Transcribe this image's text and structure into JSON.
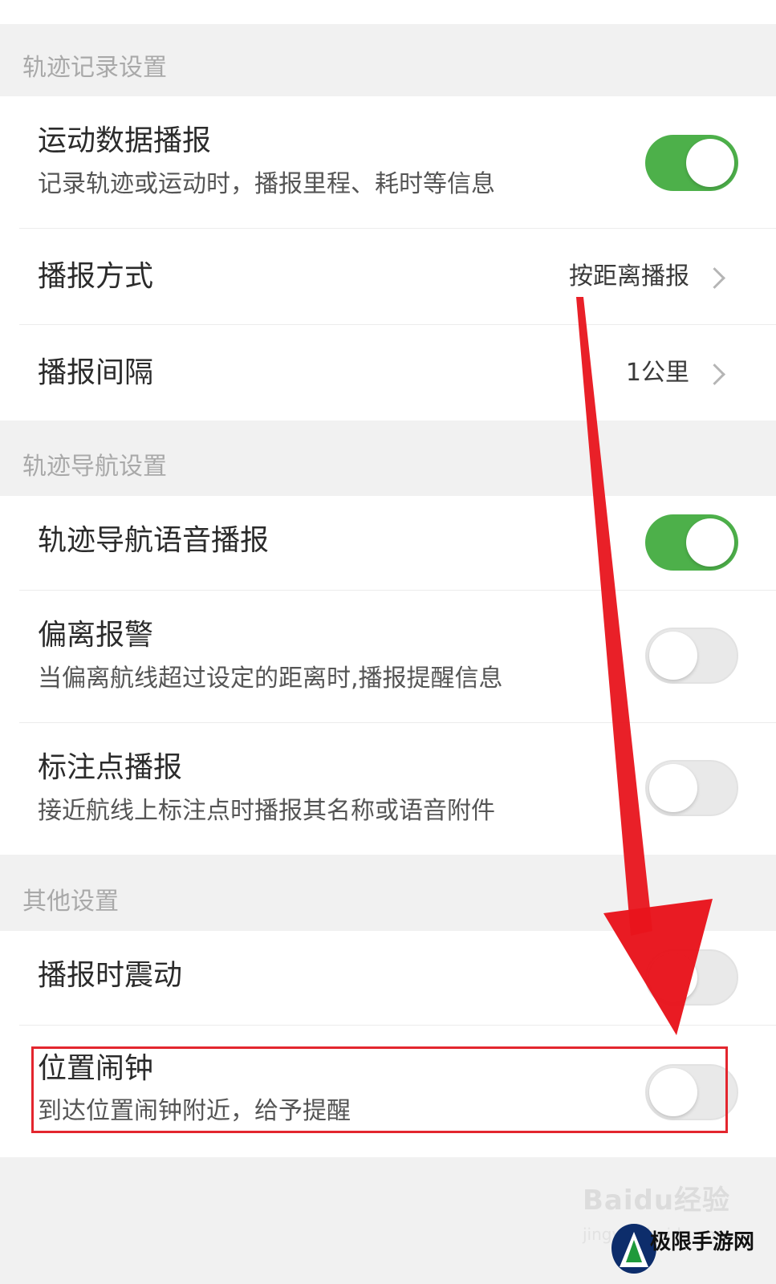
{
  "sections": {
    "track_record": {
      "header": "轨迹记录设置",
      "sport_broadcast": {
        "title": "运动数据播报",
        "subtitle": "记录轨迹或运动时，播报里程、耗时等信息",
        "toggle": "on"
      },
      "broadcast_mode": {
        "title": "播报方式",
        "value": "按距离播报"
      },
      "broadcast_interval": {
        "title": "播报间隔",
        "value": "1公里"
      }
    },
    "track_nav": {
      "header": "轨迹导航设置",
      "voice_broadcast": {
        "title": "轨迹导航语音播报",
        "toggle": "on"
      },
      "deviation_alarm": {
        "title": "偏离报警",
        "subtitle": "当偏离航线超过设定的距离时,播报提醒信息",
        "toggle": "off"
      },
      "marker_broadcast": {
        "title": "标注点播报",
        "subtitle": "接近航线上标注点时播报其名称或语音附件",
        "toggle": "off"
      }
    },
    "other": {
      "header": "其他设置",
      "vibrate": {
        "title": "播报时震动",
        "toggle": "off"
      },
      "location_alarm": {
        "title": "位置闹钟",
        "subtitle": "到达位置闹钟附近，给予提醒",
        "toggle": "off"
      }
    }
  },
  "colors": {
    "toggle_on": "#4db04a",
    "annotation_red": "#e3262e"
  },
  "watermark": {
    "baidu": "Baidu经验",
    "baidu_sub": "jingyan.baidu.com",
    "site": "极限手游网"
  }
}
